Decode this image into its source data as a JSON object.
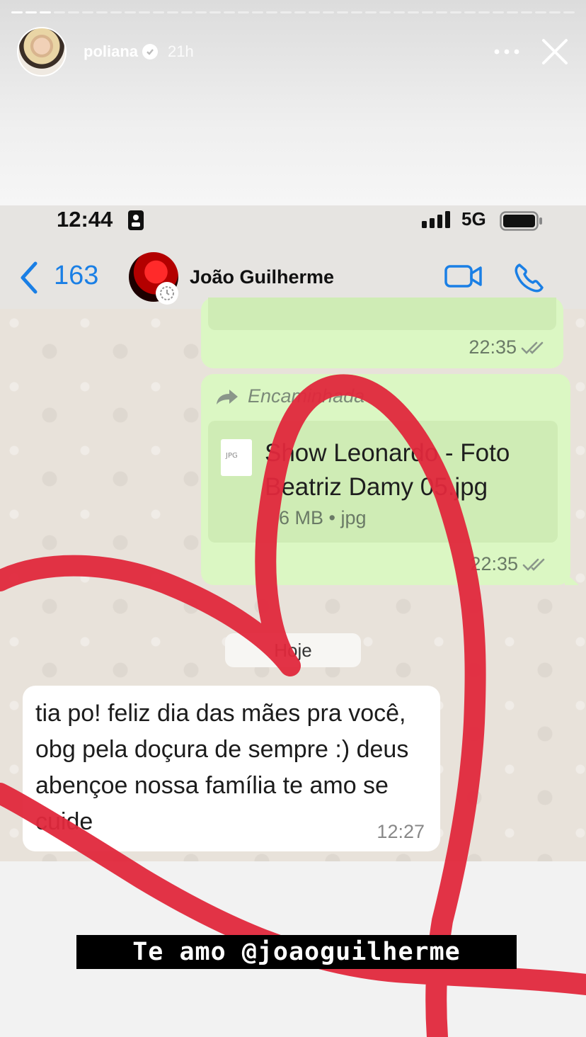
{
  "story": {
    "username": "poliana",
    "time_ago": "21h",
    "segments_total": 40,
    "segments_viewed": 3,
    "caption": "Te amo @joaoguilherme"
  },
  "status_bar": {
    "time": "12:44",
    "network": "5G"
  },
  "chat_header": {
    "back_count": "163",
    "contact_name": "João Guilherme"
  },
  "messages": {
    "msg1": {
      "time": "22:35"
    },
    "msg2": {
      "forward_label": "Encaminhada",
      "file_name": "Show Leonardo - Foto Beatriz Damy 05.jpg",
      "file_meta": "6 MB • jpg",
      "file_type_badge": "JPG",
      "time": "22:35"
    },
    "date_chip": "Hoje",
    "msg3": {
      "text": "tia po! feliz dia das mães pra você, obg pela doçura de sempre :) deus abençoe nossa família te amo se cuide",
      "time": "12:27"
    }
  },
  "colors": {
    "ios_blue": "#1a7fe5",
    "outgoing_bubble": "#dbf7c3",
    "heart_red": "#e0283c"
  }
}
